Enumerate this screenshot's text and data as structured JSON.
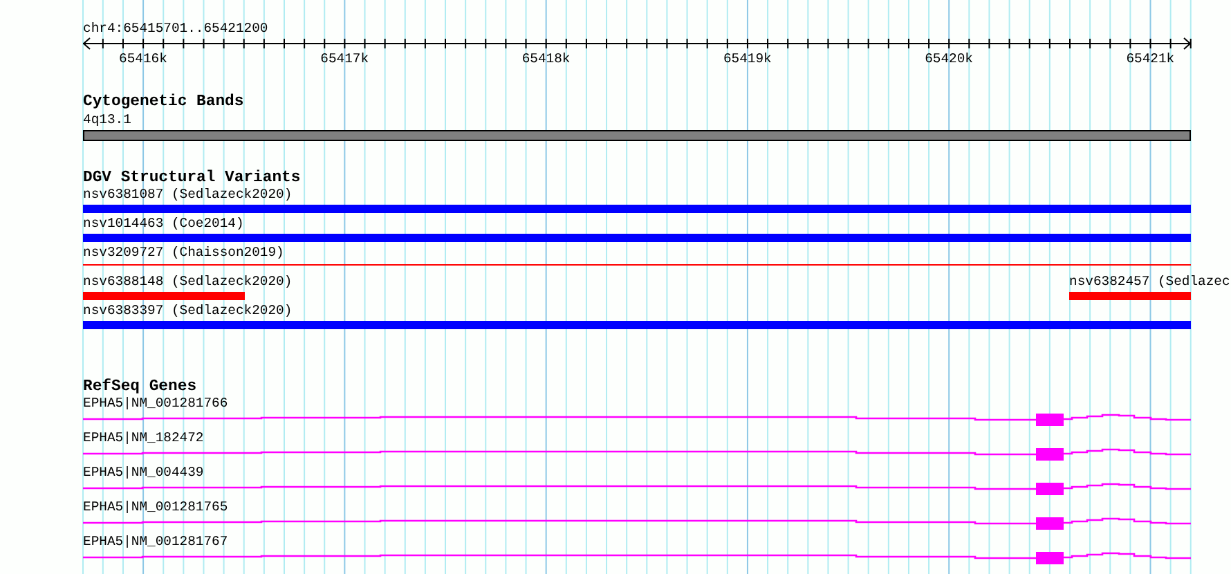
{
  "ruler": {
    "location": "chr4:65415701..65421200",
    "ticks": [
      "65416k",
      "65417k",
      "65418k",
      "65419k",
      "65420k",
      "65421k"
    ]
  },
  "tracks": [
    {
      "kind": "bands",
      "title": "Cytogenetic Bands",
      "features": [
        {
          "label": "4q13.1"
        }
      ]
    },
    {
      "kind": "variants",
      "title": "DGV Structural Variants",
      "rows": [
        [
          {
            "label": "nsv6381087 (Sedlazeck2020)",
            "color": "#0000ff",
            "kind": "thick"
          }
        ],
        [
          {
            "label": "nsv1014463 (Coe2014)",
            "color": "#0000ff",
            "kind": "thick"
          }
        ],
        [
          {
            "label": "nsv3209727 (Chaisson2019)",
            "color": "#ff0000",
            "kind": "thin"
          }
        ],
        [
          {
            "label": "nsv6388148 (Sedlazeck2020)",
            "color": "#ff0000",
            "kind": "thick"
          },
          {
            "label": "nsv6382457 (Sedlazec",
            "color": "#ff0000",
            "kind": "thick"
          }
        ],
        [
          {
            "label": "nsv6383397 (Sedlazeck2020)",
            "color": "#0000ff",
            "kind": "thick"
          }
        ]
      ]
    },
    {
      "kind": "genes",
      "title": "RefSeq Genes",
      "transcripts": [
        {
          "label": "EPHA5|NM_001281766"
        },
        {
          "label": "EPHA5|NM_182472"
        },
        {
          "label": "EPHA5|NM_004439"
        },
        {
          "label": "EPHA5|NM_001281765"
        },
        {
          "label": "EPHA5|NM_001281767"
        }
      ]
    }
  ]
}
